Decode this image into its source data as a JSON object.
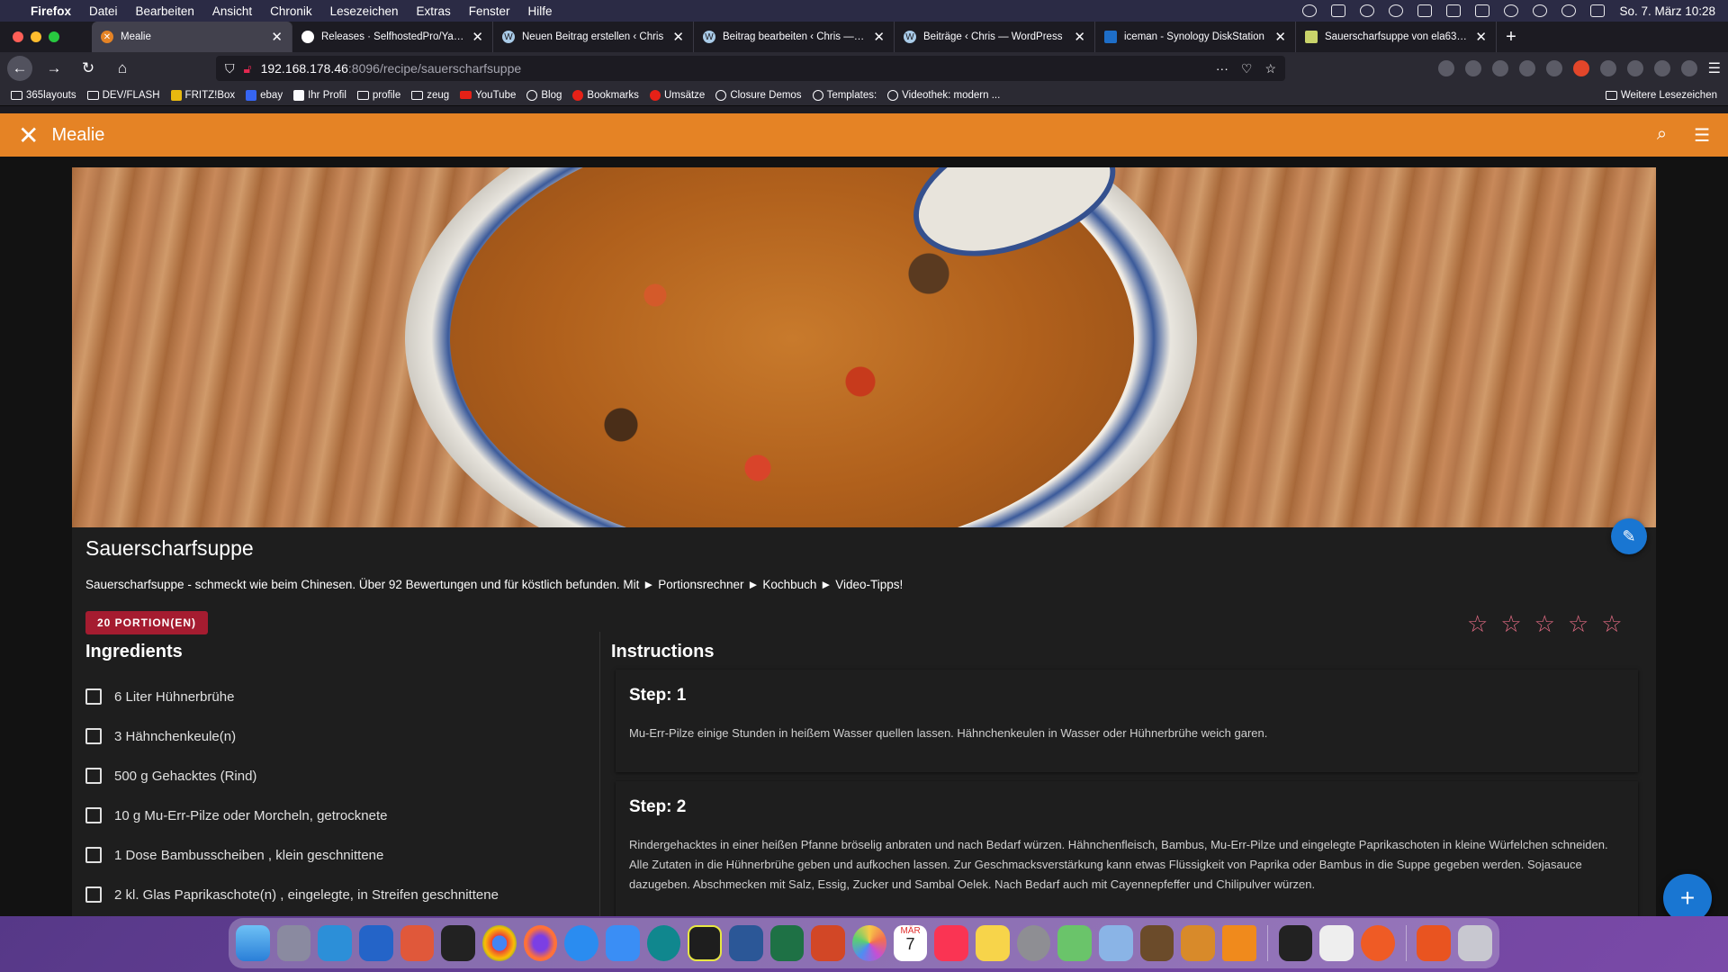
{
  "menubar": {
    "app": "Firefox",
    "items": [
      "Datei",
      "Bearbeiten",
      "Ansicht",
      "Chronik",
      "Lesezeichen",
      "Extras",
      "Fenster",
      "Hilfe"
    ],
    "clock": "So. 7. März  10:28"
  },
  "tabs": [
    {
      "title": "Mealie",
      "active": true
    },
    {
      "title": "Releases · SelfhostedPro/Yacht"
    },
    {
      "title": "Neuen Beitrag erstellen ‹ Chris"
    },
    {
      "title": "Beitrag bearbeiten ‹ Chris — W"
    },
    {
      "title": "Beiträge ‹ Chris — WordPress"
    },
    {
      "title": "iceman - Synology DiskStation"
    },
    {
      "title": "Sauerscharfsuppe von ela63 | C"
    }
  ],
  "url": {
    "host": "192.168.178.46",
    "path": ":8096/recipe/sauerscharfsuppe"
  },
  "bookmarks": [
    {
      "label": "365layouts",
      "icon": "folder"
    },
    {
      "label": "DEV/FLASH",
      "icon": "folder"
    },
    {
      "label": "FRITZ!Box",
      "icon": "gen"
    },
    {
      "label": "ebay",
      "icon": "gen"
    },
    {
      "label": "Ihr Profil",
      "icon": "gen"
    },
    {
      "label": "profile",
      "icon": "folder"
    },
    {
      "label": "zeug",
      "icon": "folder"
    },
    {
      "label": "YouTube",
      "icon": "yt"
    },
    {
      "label": "Blog",
      "icon": "glob"
    },
    {
      "label": "Bookmarks",
      "icon": "red"
    },
    {
      "label": "Umsätze",
      "icon": "red"
    },
    {
      "label": "Closure Demos",
      "icon": "glob"
    },
    {
      "label": "Templates:",
      "icon": "glob"
    },
    {
      "label": "Videothek: modern ...",
      "icon": "glob"
    }
  ],
  "bookmarks_more": "Weitere Lesezeichen",
  "app": {
    "name": "Mealie",
    "accent": "#e58325"
  },
  "recipe": {
    "title": "Sauerscharfsuppe",
    "description": "Sauerscharfsuppe - schmeckt wie beim Chinesen. Über 92 Bewertungen und für köstlich befunden. Mit ► Portionsrechner ► Kochbuch ► Video-Tipps!",
    "servings": "20 PORTION(EN)",
    "rating": 0,
    "rating_max": 5,
    "ingredients_heading": "Ingredients",
    "ingredients": [
      "6 Liter Hühnerbrühe",
      "3 Hähnchenkeule(n)",
      "500 g Gehacktes (Rind)",
      "10 g Mu-Err-Pilze oder Morcheln, getrocknete",
      "1 Dose Bambusscheiben , klein geschnittene",
      "2 kl. Glas Paprikaschote(n) , eingelegte, in Streifen geschnittene"
    ],
    "instructions_heading": "Instructions",
    "steps": [
      {
        "title": "Step: 1",
        "text": "Mu-Err-Pilze einige Stunden in heißem Wasser quellen lassen. Hähnchenkeulen in Wasser oder Hühnerbrühe weich garen."
      },
      {
        "title": "Step: 2",
        "text": "Rindergehacktes in einer heißen Pfanne bröselig anbraten und nach Bedarf würzen. Hähnchenfleisch, Bambus, Mu-Err-Pilze und eingelegte Paprikaschoten in kleine Würfelchen schneiden. Alle Zutaten in die Hühnerbrühe geben und aufkochen lassen. Zur Geschmacksverstärkung kann etwas Flüssigkeit von Paprika oder Bambus in die Suppe gegeben werden. Sojasauce dazugeben. Abschmecken mit Salz, Essig, Zucker und Sambal Oelek. Nach Bedarf auch mit Cayennepfeffer und Chilipulver würzen."
      }
    ]
  },
  "dock": {
    "apps": [
      "finder",
      "launchpad",
      "vscode",
      "teamviewer",
      "git",
      "terminal",
      "chrome",
      "firefox",
      "safari",
      "mail",
      "arduino",
      "pycharm",
      "word",
      "excel",
      "powerpoint",
      "photos",
      "calendar",
      "music",
      "notes",
      "system-preferences",
      "maps",
      "preview",
      "calibre",
      "books",
      "vlc",
      "terminal2",
      "textedit",
      "postman",
      "ubuntu",
      "trash"
    ],
    "calendar_month": "MÄR",
    "calendar_day": "7"
  }
}
